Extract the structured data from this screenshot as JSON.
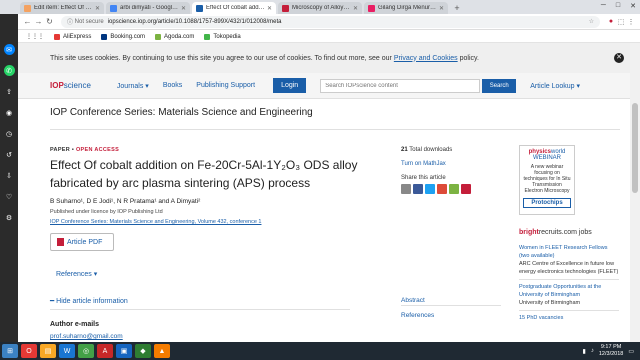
{
  "browser": {
    "tabs": [
      {
        "label": "Edit item: Effect Of cobalt",
        "color": "#f4a261"
      },
      {
        "label": "arbi dimyati - Google Scho",
        "color": "#4285f4"
      },
      {
        "label": "Effect Of cobalt addition o",
        "color": "#1a5ea8"
      },
      {
        "label": "Microscopy of Alloy Forma",
        "color": "#c41e3a"
      },
      {
        "label": "Gilang Dirga Menuru Artic",
        "color": "#e91e63"
      }
    ],
    "not_secure": "Not secure",
    "url": "iopscience.iop.org/article/10.1088/1757-899X/432/1/012008/meta",
    "bookmarks": [
      {
        "label": "AliExpress",
        "color": "#e53935"
      },
      {
        "label": "Booking.com",
        "color": "#003580"
      },
      {
        "label": "Agoda.com",
        "color": "#7cb342"
      },
      {
        "label": "Tokopedia",
        "color": "#42b549"
      }
    ]
  },
  "cookie_notice": {
    "text": "This site uses cookies. By continuing to use this site you agree to our use of cookies. To find out more, see our ",
    "link": "Privacy and Cookies",
    "suffix": " policy."
  },
  "header": {
    "logo_iop": "IOP",
    "logo_science": "science",
    "nav": [
      "Journals ▾",
      "Books",
      "Publishing Support",
      "Login"
    ],
    "search_placeholder": "Search IOPscience content",
    "search_button": "Search",
    "article_lookup": "Article Lookup ▾"
  },
  "journal_title": "IOP Conference Series: Materials Science and Engineering",
  "article": {
    "label_paper": "PAPER",
    "label_open_access": "OPEN ACCESS",
    "title_line1": "Effect Of cobalt addition on Fe-20Cr-5Al-1Y₂O₃ ODS alloy",
    "title_line2": "fabricated by arc plasma sintering (APS) process",
    "authors": "B Suharno¹, D E Jodi¹, N R Pratama¹ and A Dimyati²",
    "license": "Published under licence by IOP Publishing Ltd",
    "citation": "IOP Conference Series: Materials Science and Engineering, Volume 432, conference 1",
    "pdf_button": "Article PDF",
    "references": "References ▾",
    "hide_info": "━ Hide article information",
    "author_emails": "Author e-mails",
    "email": "prof.suharno@gmail.com"
  },
  "metrics": {
    "downloads_count": "21",
    "downloads_label": "Total downloads",
    "mathjax": "Turn on MathJax",
    "share_label": "Share this article",
    "share_colors": [
      "#888888",
      "#3b5998",
      "#1da1f2",
      "#dd4b39",
      "#7cb342",
      "#c41e3a"
    ]
  },
  "side_nav": {
    "abstract": "Abstract",
    "references": "References"
  },
  "ad": {
    "brand_physics": "physics",
    "brand_world": "world",
    "brand_webinar": "WEBINAR",
    "text": "A new webinar focusing on techniques for In Situ Transmission Electron Microscopy",
    "sponsor": "Protochips"
  },
  "jobs": {
    "brand_bright": "bright",
    "brand_rest": "recruits.com jobs",
    "items": [
      {
        "title": "Women in FLEET Research Fellows (two available)",
        "org": "ARC Centre of Excellence in future low energy electronics technologies (FLEET)"
      },
      {
        "title": "Postgraduate Opportunities at the University of Birmingham",
        "org": "University of Birmingham"
      },
      {
        "title": "15 PhD vacancies",
        "org": ""
      }
    ]
  },
  "taskbar": {
    "time": "9:17 PM",
    "date": "12/3/2018",
    "apps": [
      "#3b82c4",
      "#e53935",
      "#f9a825",
      "#1976d2",
      "#43a047",
      "#c62828",
      "#1565c0",
      "#2e7d32",
      "#f57c00"
    ]
  }
}
